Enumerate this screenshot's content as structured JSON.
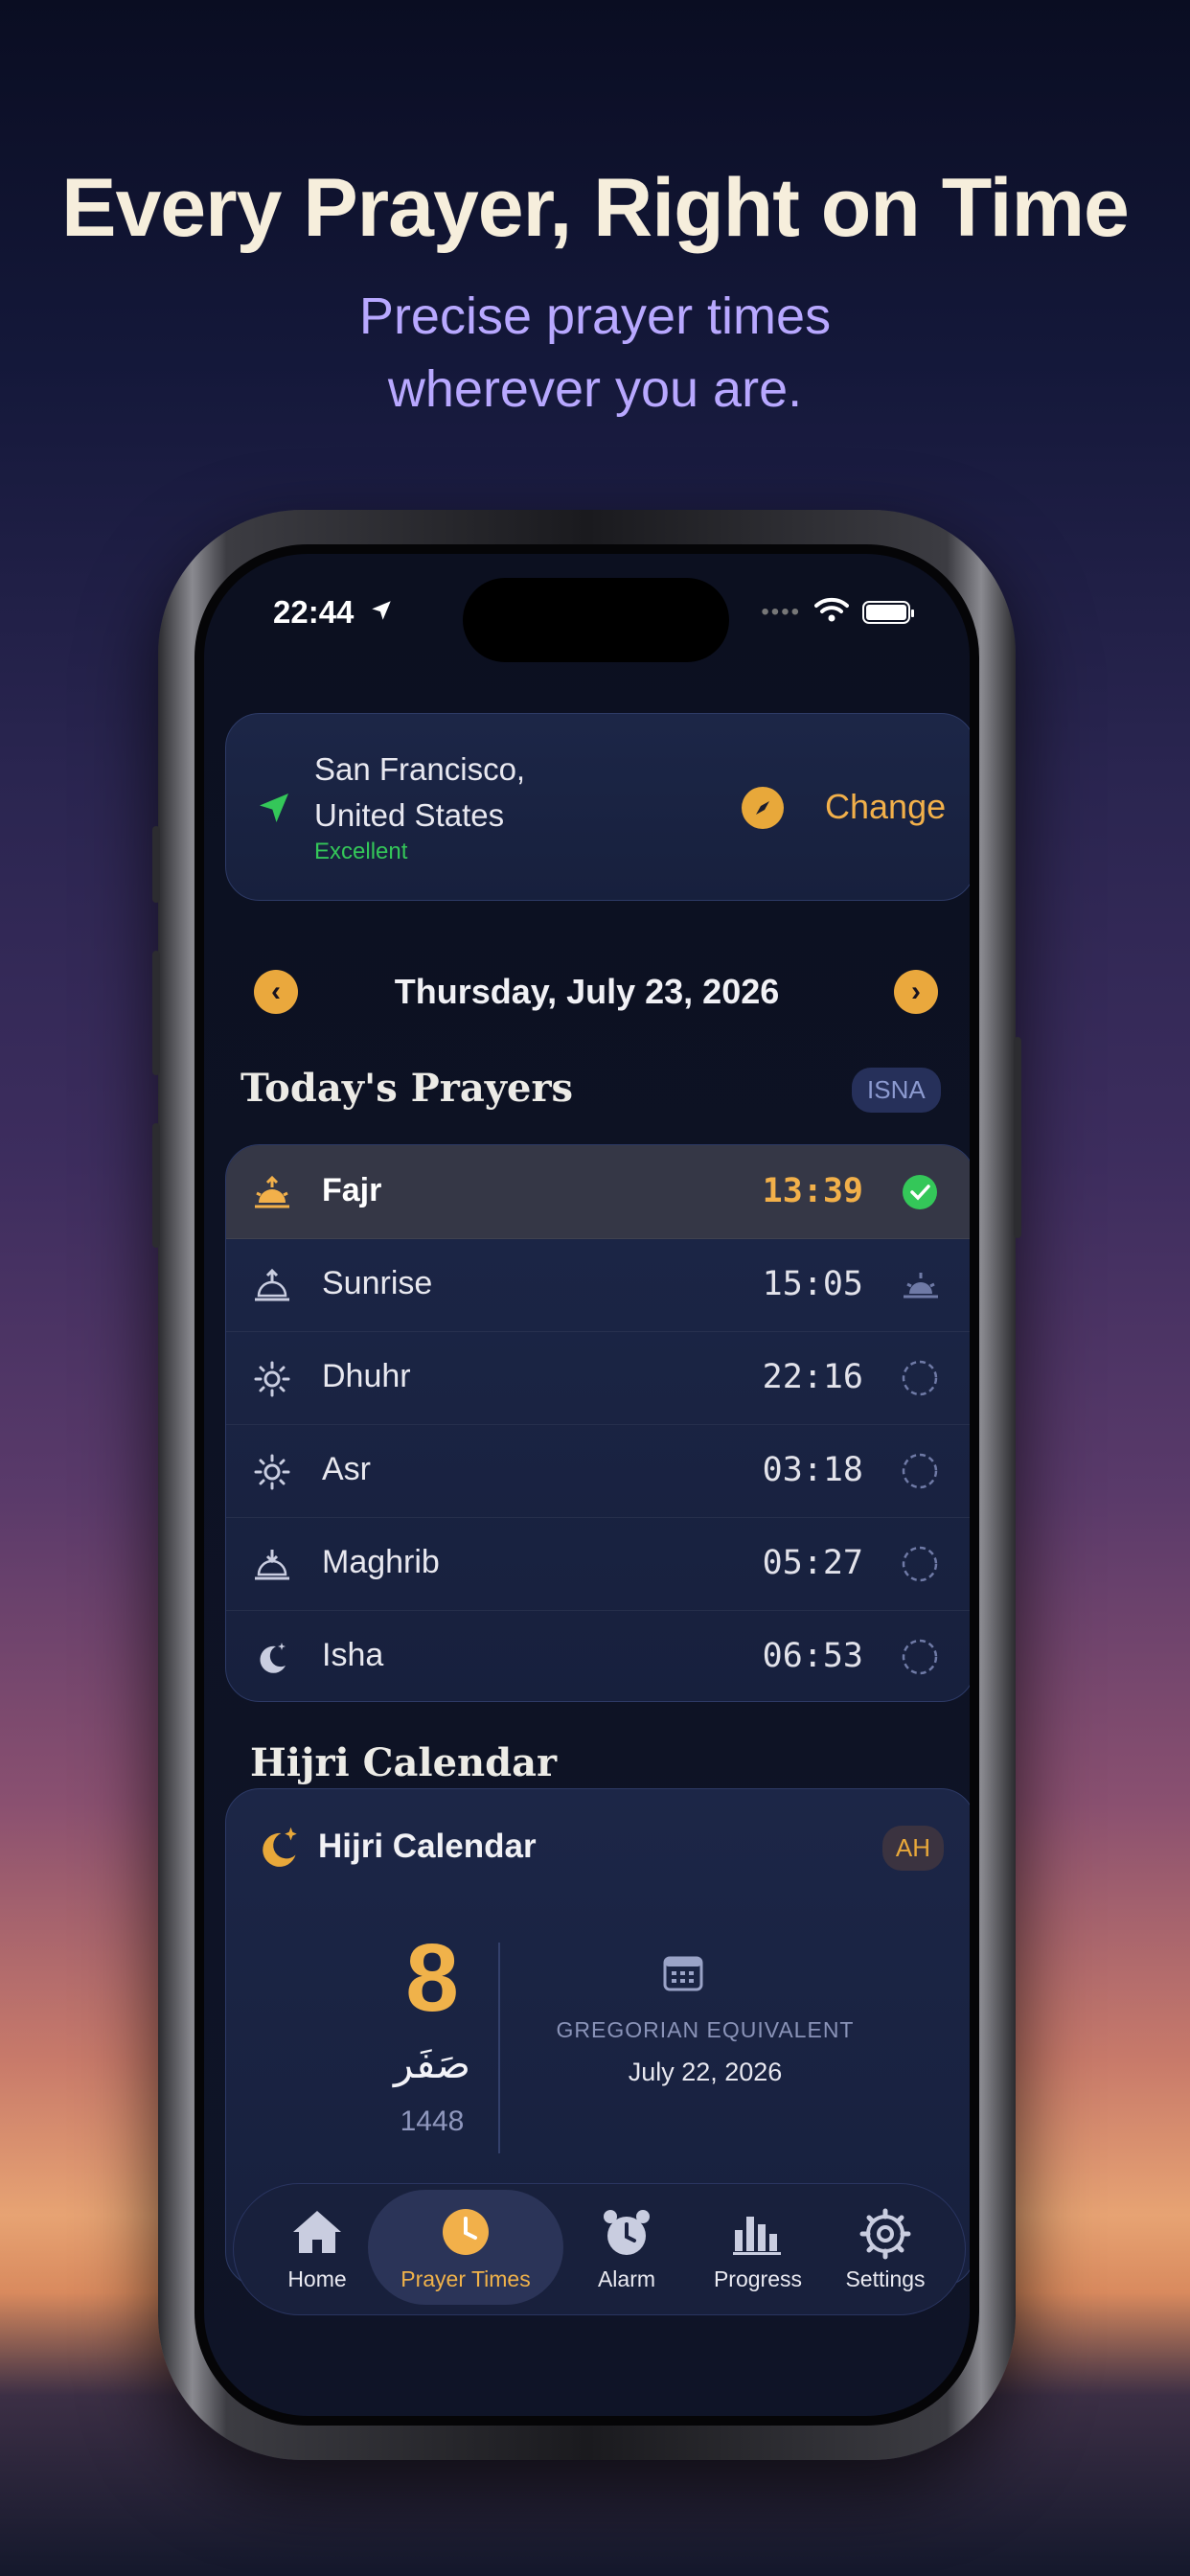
{
  "marketing": {
    "headline": "Every Prayer, Right on Time",
    "subheadline_line1": "Precise prayer times",
    "subheadline_line2": "wherever you are."
  },
  "status_bar": {
    "time": "22:44"
  },
  "location": {
    "city_line1": "San Francisco,",
    "city_line2": "United States",
    "quality": "Excellent",
    "change_label": "Change"
  },
  "date_nav": {
    "date": "Thursday, July 23, 2026"
  },
  "prayers_section": {
    "title": "Today's Prayers",
    "method_badge": "ISNA",
    "items": [
      {
        "name": "Fajr",
        "time": "13:39",
        "icon": "sunrise-icon",
        "status": "completed"
      },
      {
        "name": "Sunrise",
        "time": "15:05",
        "icon": "sunrise-icon",
        "status": "sunrise"
      },
      {
        "name": "Dhuhr",
        "time": "22:16",
        "icon": "sun-icon",
        "status": "pending"
      },
      {
        "name": "Asr",
        "time": "03:18",
        "icon": "sun-icon",
        "status": "pending"
      },
      {
        "name": "Maghrib",
        "time": "05:27",
        "icon": "sunset-icon",
        "status": "pending"
      },
      {
        "name": "Isha",
        "time": "06:53",
        "icon": "moon-icon",
        "status": "pending"
      }
    ]
  },
  "hijri_section": {
    "title": "Hijri Calendar",
    "card_title": "Hijri Calendar",
    "badge": "AH",
    "day": "8",
    "month": "صَفَر",
    "year": "1448",
    "greg_label": "GREGORIAN EQUIVALENT",
    "greg_date": "July 22, 2026"
  },
  "tabbar": {
    "tabs": [
      {
        "label": "Home",
        "icon": "house-icon"
      },
      {
        "label": "Prayer Times",
        "icon": "clock-icon",
        "selected": true
      },
      {
        "label": "Alarm",
        "icon": "alarm-clock-icon"
      },
      {
        "label": "Progress",
        "icon": "bar-chart-icon"
      },
      {
        "label": "Settings",
        "icon": "gear-icon"
      }
    ]
  },
  "colors": {
    "accent": "#f2b04a",
    "success": "#34c759",
    "headline": "#f6eedc",
    "subheadline": "#b8a8ff"
  }
}
